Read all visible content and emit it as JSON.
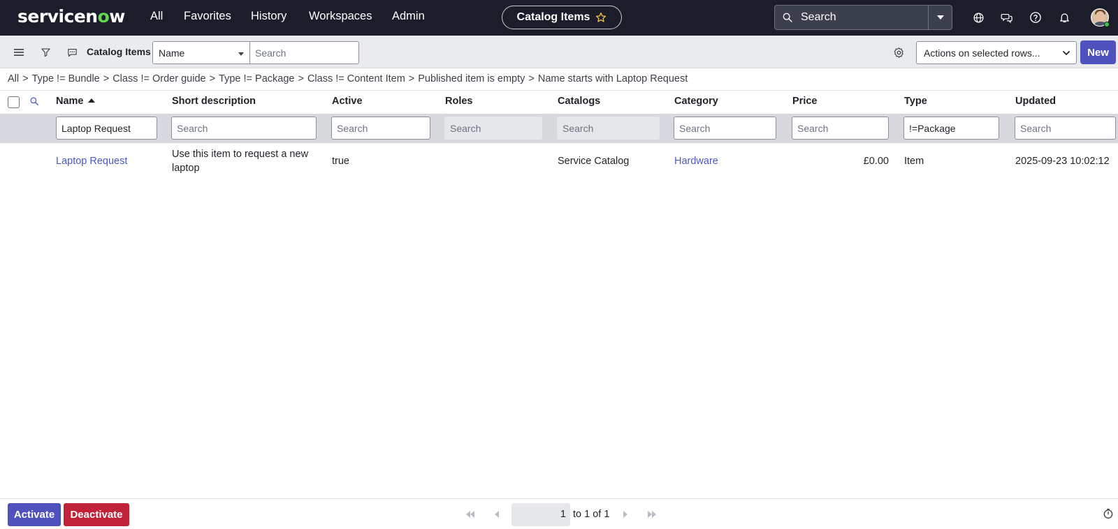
{
  "header": {
    "logo": {
      "pre": "servicen",
      "o": "o",
      "post": "w"
    },
    "nav": [
      "All",
      "Favorites",
      "History",
      "Workspaces",
      "Admin"
    ],
    "context_title": "Catalog Items",
    "search_placeholder": "Search",
    "icons": [
      "globe-icon",
      "chat-icon",
      "help-icon",
      "bell-icon",
      "avatar"
    ]
  },
  "toolbar": {
    "list_title": "Catalog Items",
    "field_select": "Name",
    "search_placeholder": "Search",
    "actions_select": "Actions on selected rows...",
    "new_label": "New"
  },
  "breadcrumb": [
    "All",
    "Type != Bundle",
    "Class != Order guide",
    "Type != Package",
    "Class != Content Item",
    "Published item is empty",
    "Name starts with Laptop Request"
  ],
  "table": {
    "columns": [
      "Name",
      "Short description",
      "Active",
      "Roles",
      "Catalogs",
      "Category",
      "Price",
      "Type",
      "Updated"
    ],
    "filters": [
      "Laptop Request",
      "Search",
      "Search",
      "Search",
      "Search",
      "Search",
      "Search",
      "!=Package",
      "Search"
    ],
    "rows": [
      {
        "name": "Laptop Request",
        "short_description": "Use this item to request a new laptop",
        "desc_line1": "Use this item to request a new",
        "desc_line2": "laptop",
        "active": "true",
        "roles": "",
        "catalogs": "Service Catalog",
        "category": "Hardware",
        "price": "£0.00",
        "type": "Item",
        "updated": "2025-09-23 10:02:12"
      }
    ]
  },
  "footer": {
    "activate_label": "Activate",
    "deactivate_label": "Deactivate",
    "page_number": "1",
    "page_range": "to 1 of 1"
  },
  "colors": {
    "nav_bg": "#1b1e2a",
    "primary_button": "#4f52bd",
    "danger_button": "#c1223a",
    "link": "#4a58c4",
    "filter_row_bg": "#d7d9de"
  }
}
